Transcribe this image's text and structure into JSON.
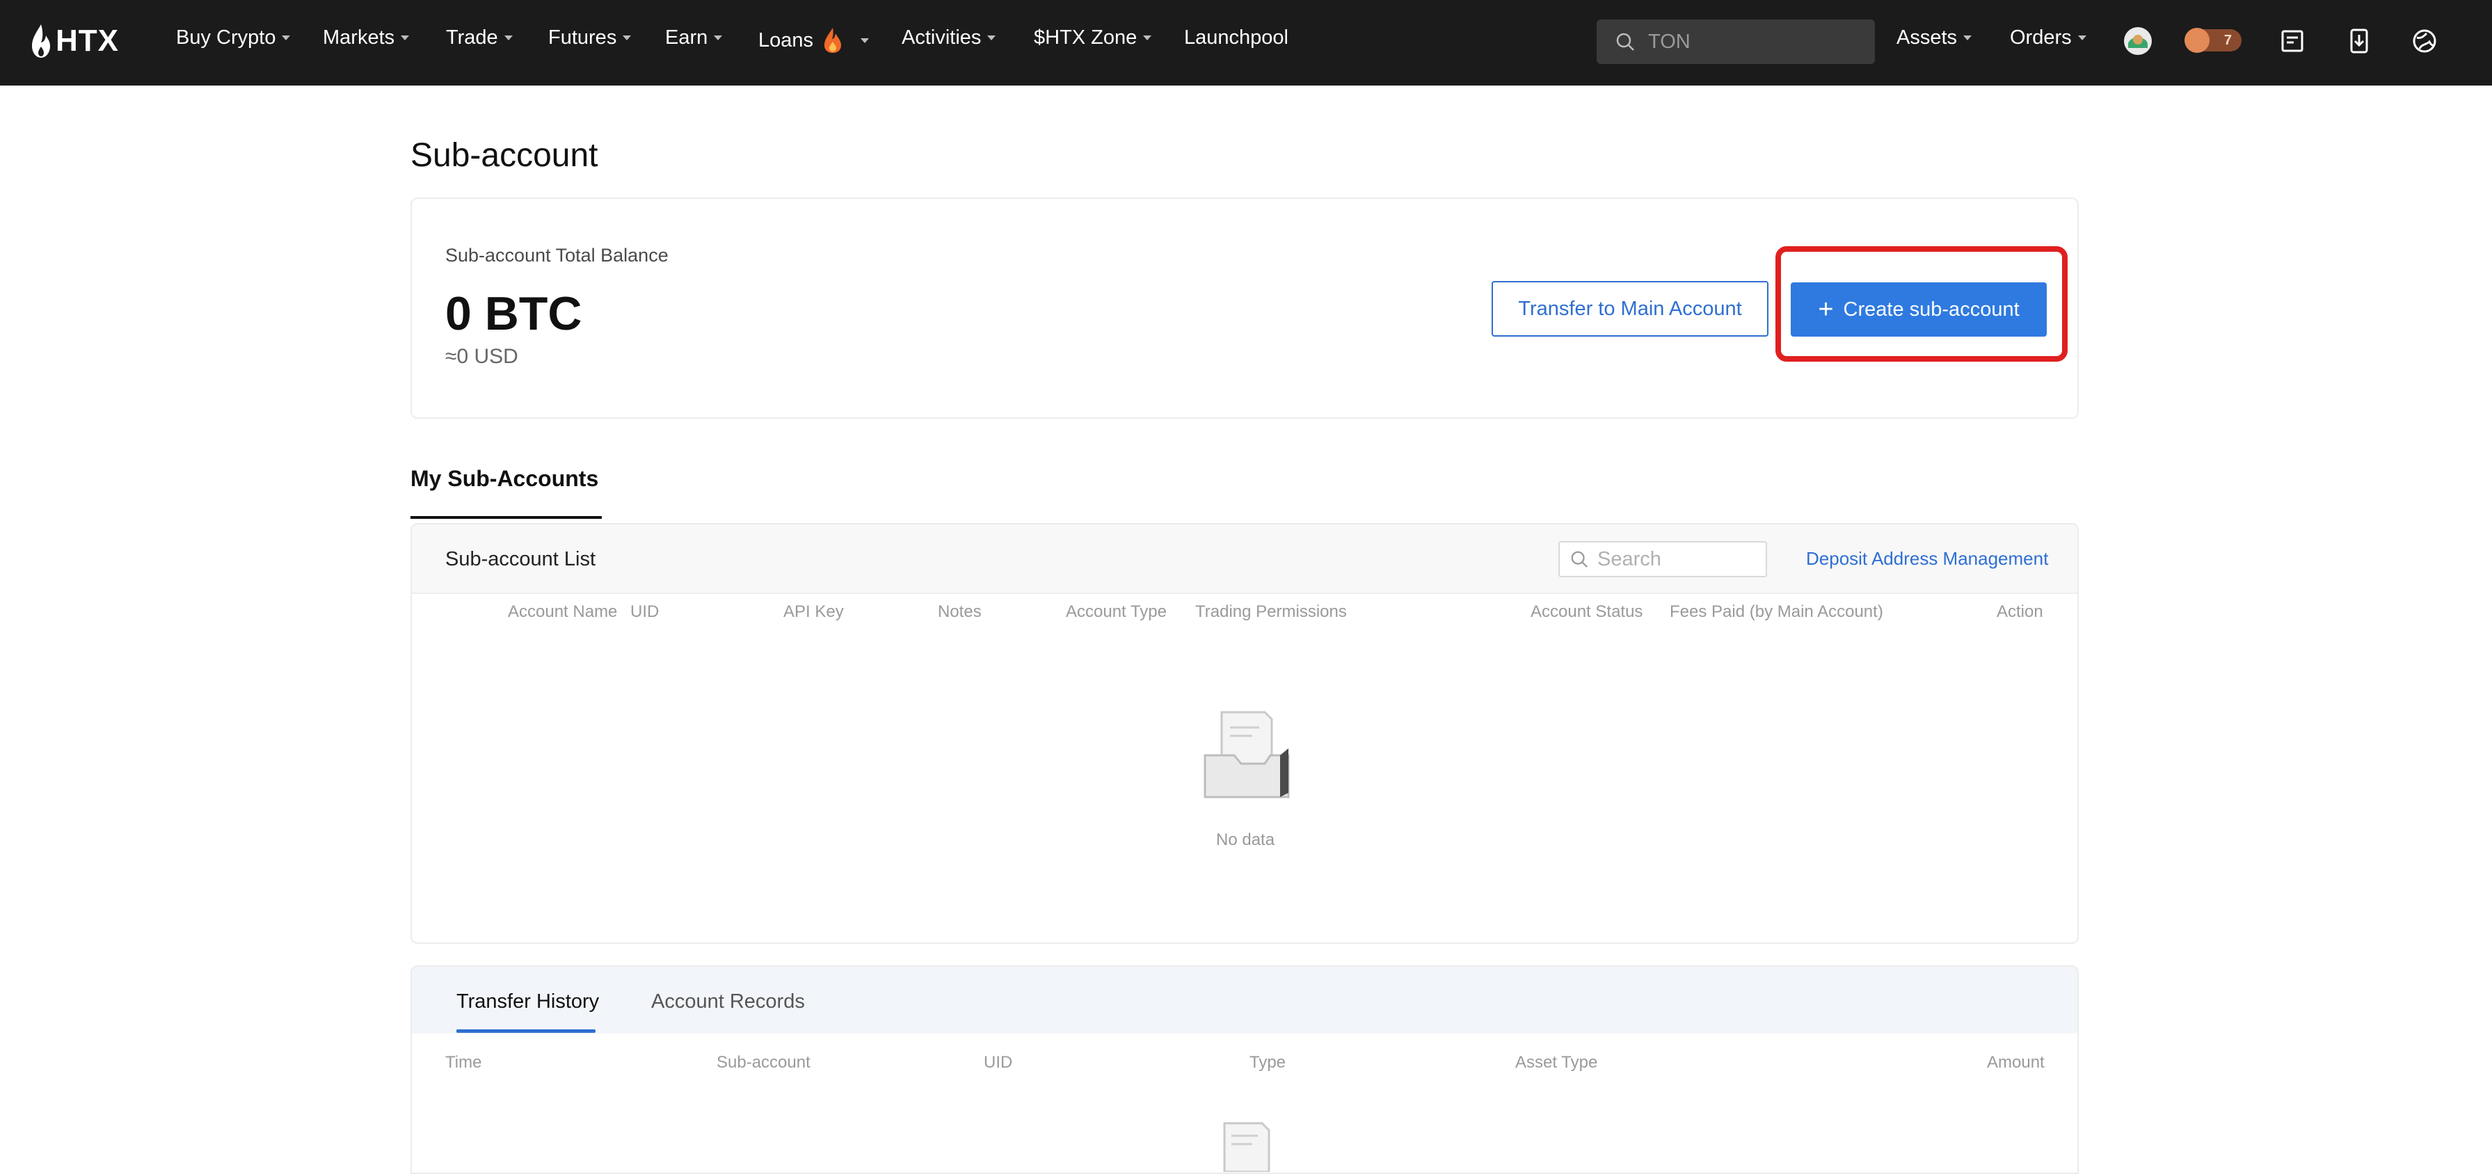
{
  "nav": {
    "logo_text": "HTX",
    "items": [
      {
        "label": "Buy Crypto",
        "caret": true
      },
      {
        "label": "Markets",
        "caret": true
      },
      {
        "label": "Trade",
        "caret": true
      },
      {
        "label": "Futures",
        "caret": true
      },
      {
        "label": "Earn",
        "caret": true
      },
      {
        "label": "Loans",
        "caret": true
      },
      {
        "label": "Activities",
        "caret": true
      },
      {
        "label": "$HTX Zone",
        "caret": true
      },
      {
        "label": "Launchpool",
        "caret": false
      }
    ],
    "search_placeholder": "TON",
    "assets_label": "Assets",
    "orders_label": "Orders",
    "badge_count": "7",
    "icons": [
      "avatar",
      "rewards-badge",
      "notes-icon",
      "download-icon",
      "globe-settings-icon"
    ]
  },
  "page": {
    "title": "Sub-account",
    "balance_label": "Sub-account Total Balance",
    "balance_value": "0 BTC",
    "balance_usd": "≈0 USD",
    "transfer_button": "Transfer to Main Account",
    "create_button": "Create sub-account",
    "highlight_color": "#e0201f",
    "accent_color": "#2f7ae0"
  },
  "tabs": {
    "my_sub_accounts": "My Sub-Accounts"
  },
  "list": {
    "title": "Sub-account List",
    "search_placeholder": "Search",
    "deposit_link": "Deposit Address Management",
    "columns": [
      "Account Name",
      "UID",
      "API Key",
      "Notes",
      "Account Type",
      "Trading Permissions",
      "Account Status",
      "Fees Paid (by Main Account)",
      "Action"
    ],
    "rows": [],
    "empty_text": "No data"
  },
  "history": {
    "tabs": [
      {
        "label": "Transfer History",
        "active": true
      },
      {
        "label": "Account Records",
        "active": false
      }
    ],
    "columns": [
      "Time",
      "Sub-account",
      "UID",
      "Type",
      "Asset Type",
      "Amount"
    ],
    "rows": []
  }
}
